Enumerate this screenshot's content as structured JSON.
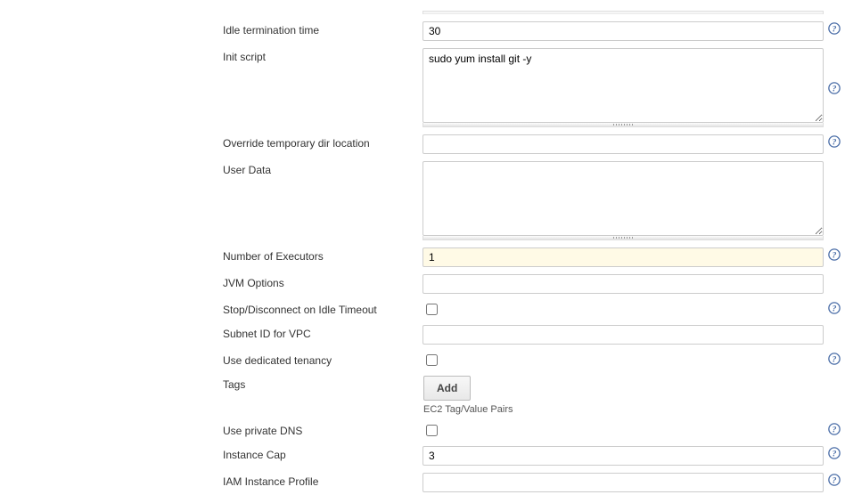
{
  "fields": {
    "idle_termination_time": {
      "label": "Idle termination time",
      "value": "30"
    },
    "init_script": {
      "label": "Init script",
      "value": "sudo yum install git -y"
    },
    "override_tmp_dir": {
      "label": "Override temporary dir location",
      "value": ""
    },
    "user_data": {
      "label": "User Data",
      "value": ""
    },
    "num_executors": {
      "label": "Number of Executors",
      "value": "1"
    },
    "jvm_options": {
      "label": "JVM Options",
      "value": ""
    },
    "stop_disconnect_idle": {
      "label": "Stop/Disconnect on Idle Timeout",
      "checked": false
    },
    "subnet_id_vpc": {
      "label": "Subnet ID for VPC",
      "value": ""
    },
    "use_dedicated_tenancy": {
      "label": "Use dedicated tenancy",
      "checked": false
    },
    "tags": {
      "label": "Tags",
      "button": "Add",
      "note": "EC2 Tag/Value Pairs"
    },
    "use_private_dns": {
      "label": "Use private DNS",
      "checked": false
    },
    "instance_cap": {
      "label": "Instance Cap",
      "value": "3"
    },
    "iam_instance_profile": {
      "label": "IAM Instance Profile",
      "value": ""
    }
  }
}
